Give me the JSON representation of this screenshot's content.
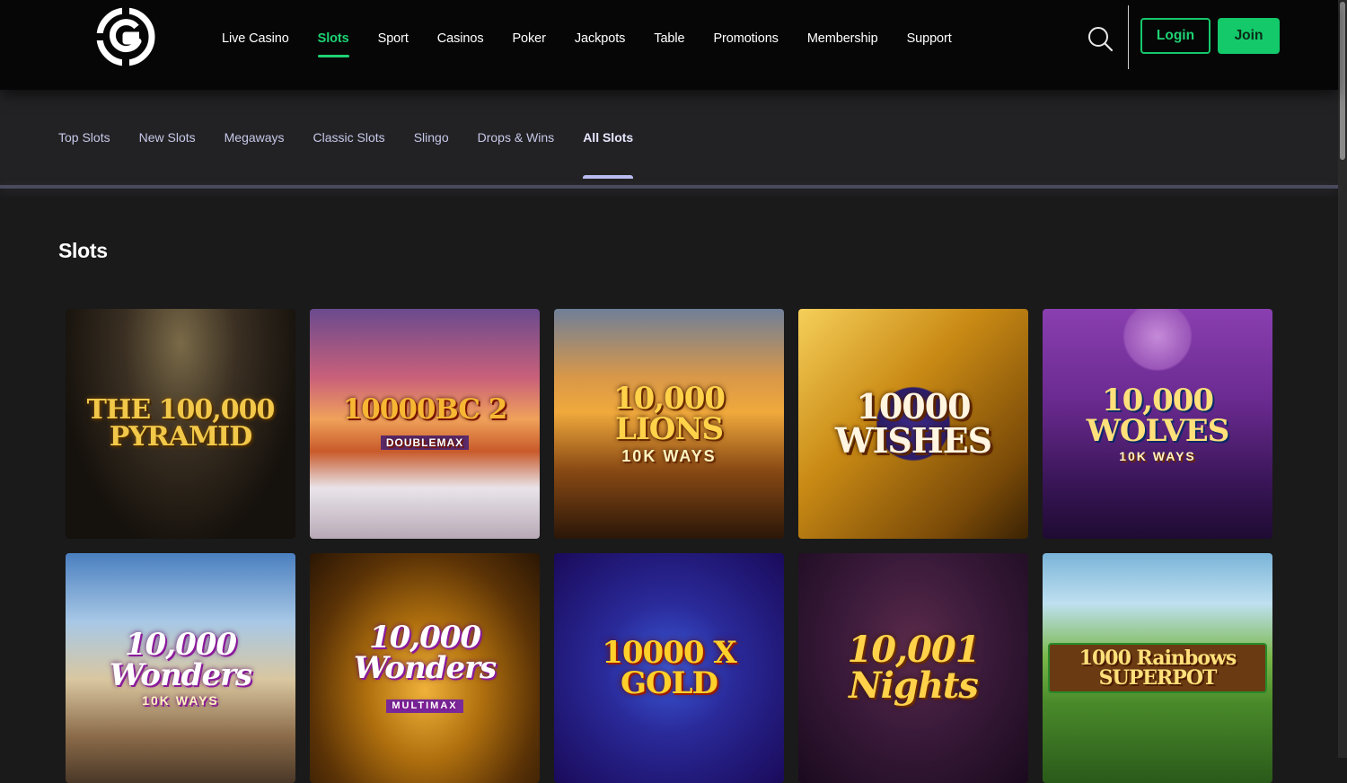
{
  "header": {
    "nav": [
      "Live Casino",
      "Slots",
      "Sport",
      "Casinos",
      "Poker",
      "Jackpots",
      "Table",
      "Promotions",
      "Membership",
      "Support"
    ],
    "active_nav": "Slots",
    "login_label": "Login",
    "join_label": "Join",
    "accent_color": "#1ed173"
  },
  "subnav": {
    "items": [
      "Top Slots",
      "New Slots",
      "Megaways",
      "Classic Slots",
      "Slingo",
      "Drops & Wins",
      "All Slots"
    ],
    "active": "All Slots"
  },
  "page": {
    "title": "Slots"
  },
  "games": [
    {
      "title": "THE 100,000 PYRAMID",
      "sub": ""
    },
    {
      "title": "10000BC 2",
      "sub": "DOUBLEMAX"
    },
    {
      "title": "10,000 LIONS",
      "sub": "10K WAYS"
    },
    {
      "title": "10000 WISHES",
      "sub": ""
    },
    {
      "title": "10,000 WOLVES",
      "sub": "10K WAYS"
    },
    {
      "title": "10,000 Wonders",
      "sub": "10K WAYS"
    },
    {
      "title": "10,000 Wonders",
      "sub": "MULTIMAX"
    },
    {
      "title": "10000 X GOLD",
      "sub": ""
    },
    {
      "title": "10,001 Nights",
      "sub": ""
    },
    {
      "title": "1000 Rainbows SUPERPOT",
      "sub": ""
    }
  ]
}
